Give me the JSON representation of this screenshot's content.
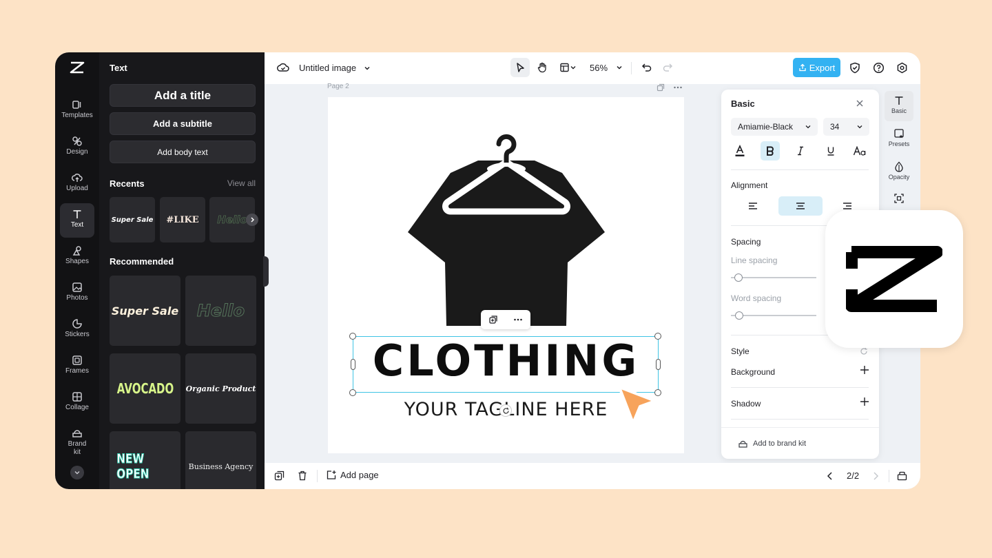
{
  "app": {
    "doc_title": "Untitled image",
    "zoom": "56%",
    "export_label": "Export"
  },
  "rail": {
    "items": [
      {
        "label": "Templates",
        "icon": "templates-icon"
      },
      {
        "label": "Design",
        "icon": "design-icon"
      },
      {
        "label": "Upload",
        "icon": "upload-icon"
      },
      {
        "label": "Text",
        "icon": "text-icon",
        "active": true
      },
      {
        "label": "Shapes",
        "icon": "shapes-icon"
      },
      {
        "label": "Photos",
        "icon": "photos-icon"
      },
      {
        "label": "Stickers",
        "icon": "stickers-icon"
      },
      {
        "label": "Frames",
        "icon": "frames-icon"
      },
      {
        "label": "Collage",
        "icon": "collage-icon"
      },
      {
        "label": "Brand kit",
        "icon": "brand-kit-icon"
      }
    ]
  },
  "text_panel": {
    "title": "Text",
    "add_title": "Add a title",
    "add_subtitle": "Add a subtitle",
    "add_body": "Add body text",
    "recents_title": "Recents",
    "view_all": "View all",
    "recents": [
      "Super Sale",
      "#LIKE",
      "Hello"
    ],
    "recommended_title": "Recommended",
    "recommended": [
      "Super Sale",
      "Hello",
      "AVOCADO",
      "Organic Product",
      "NEW OPEN",
      "Business Agency"
    ]
  },
  "canvas": {
    "page_label": "Page 2",
    "headline": "CLOTHING",
    "tagline": "YOUR TAGLINE HERE"
  },
  "props": {
    "title": "Basic",
    "font": "Amiamie-Black",
    "size": "34",
    "alignment_label": "Alignment",
    "alignment_value": "center",
    "spacing_label": "Spacing",
    "line_spacing": "Line spacing",
    "word_spacing": "Word spacing",
    "style_label": "Style",
    "background": "Background",
    "shadow": "Shadow",
    "brand_kit": "Add to brand kit"
  },
  "right_rail": {
    "items": [
      "Basic",
      "Presets",
      "Opacity"
    ]
  },
  "bottom": {
    "add_page": "Add page",
    "page_indicator": "2/2"
  },
  "colors": {
    "accent": "#33b2f2",
    "selection": "#3ec3e4",
    "cursor": "#f7a35b",
    "background": "#fde3c6"
  }
}
